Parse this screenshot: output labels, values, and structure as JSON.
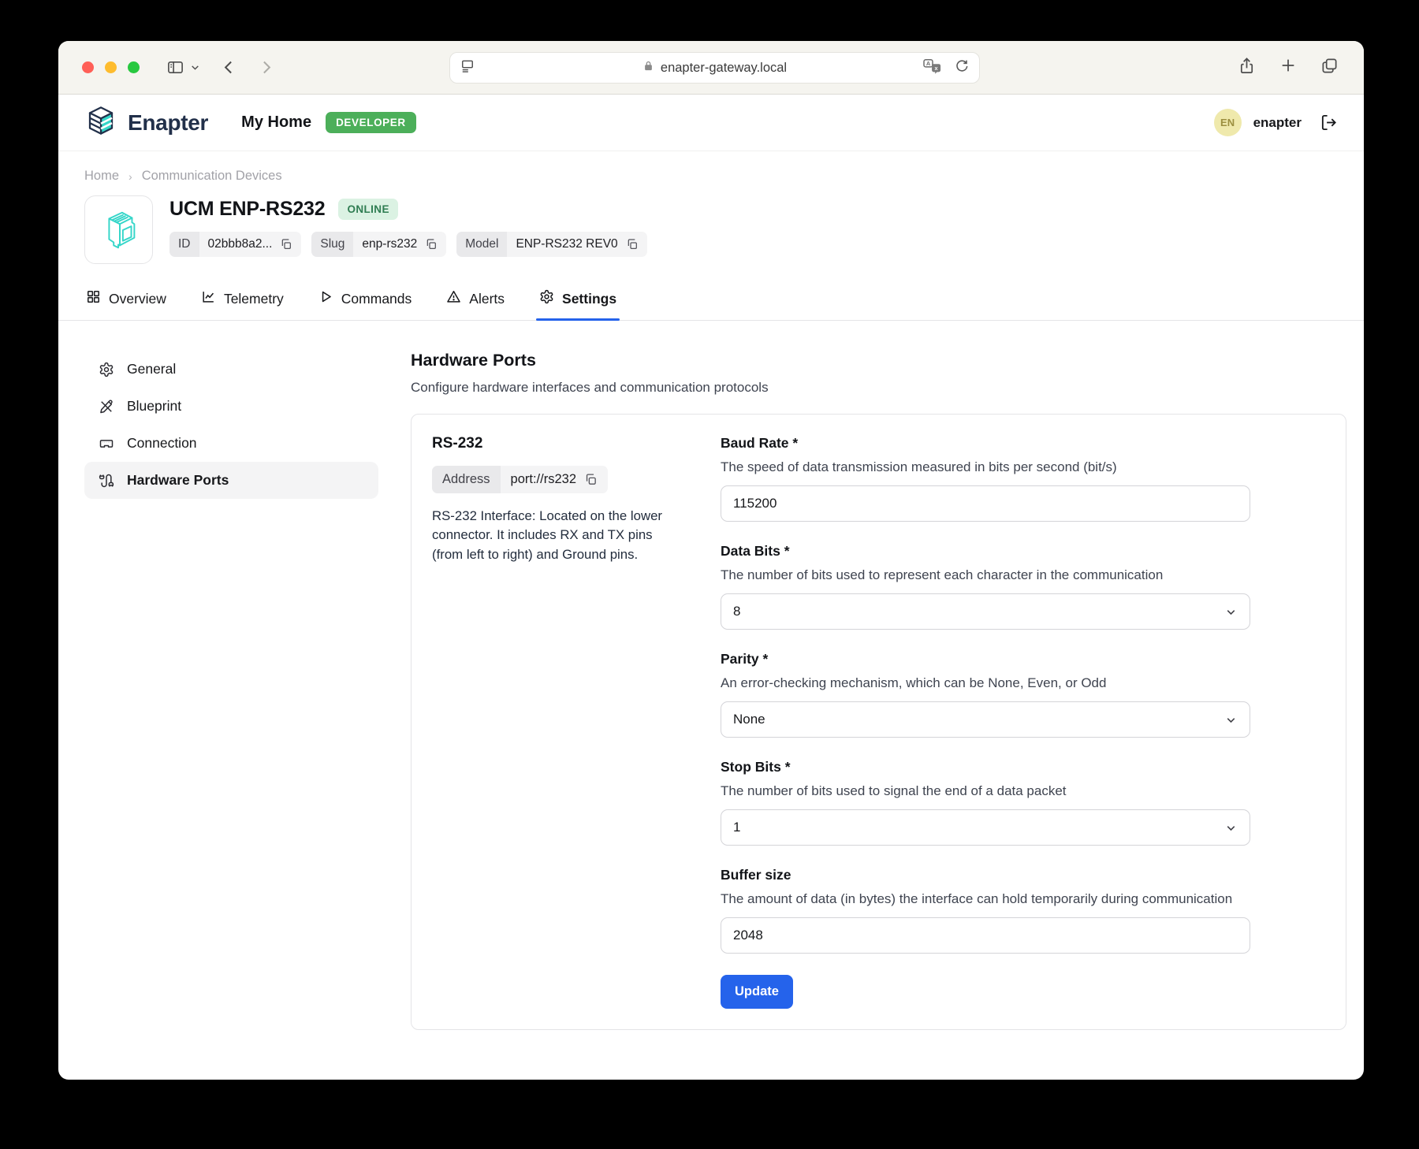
{
  "browser": {
    "url": "enapter-gateway.local"
  },
  "app_header": {
    "brand": "Enapter",
    "workspace": "My Home",
    "role_badge": "DEVELOPER",
    "user_initials": "EN",
    "user_name": "enapter"
  },
  "breadcrumb": {
    "home": "Home",
    "section": "Communication Devices"
  },
  "device": {
    "name": "UCM ENP-RS232",
    "status": "ONLINE",
    "meta": [
      {
        "key": "ID",
        "value": "02bbb8a2..."
      },
      {
        "key": "Slug",
        "value": "enp-rs232"
      },
      {
        "key": "Model",
        "value": "ENP-RS232 REV0"
      }
    ]
  },
  "tabs": {
    "items": [
      {
        "label": "Overview"
      },
      {
        "label": "Telemetry"
      },
      {
        "label": "Commands"
      },
      {
        "label": "Alerts"
      },
      {
        "label": "Settings"
      }
    ],
    "active": "Settings"
  },
  "settings_nav": {
    "items": [
      {
        "label": "General"
      },
      {
        "label": "Blueprint"
      },
      {
        "label": "Connection"
      },
      {
        "label": "Hardware Ports"
      }
    ],
    "active": "Hardware Ports"
  },
  "main": {
    "title": "Hardware Ports",
    "subtitle": "Configure hardware interfaces and communication protocols",
    "card": {
      "section_title": "RS-232",
      "address": {
        "key": "Address",
        "value": "port://rs232"
      },
      "description": "RS-232 Interface: Located on the lower connector. It includes RX and TX pins (from left to right) and Ground pins.",
      "fields": [
        {
          "label": "Baud Rate",
          "required_mark": "*",
          "help": "The speed of data transmission measured in bits per second (bit/s)",
          "value": "115200",
          "control": "input"
        },
        {
          "label": "Data Bits",
          "required_mark": "*",
          "help": "The number of bits used to represent each character in the communication",
          "value": "8",
          "control": "select"
        },
        {
          "label": "Parity",
          "required_mark": "*",
          "help": "An error-checking mechanism, which can be None, Even, or Odd",
          "value": "None",
          "control": "select"
        },
        {
          "label": "Stop Bits",
          "required_mark": "*",
          "help": "The number of bits used to signal the end of a data packet",
          "value": "1",
          "control": "select"
        },
        {
          "label": "Buffer size",
          "help": "The amount of data (in bytes) the interface can hold temporarily during communication",
          "value": "2048",
          "control": "input"
        }
      ],
      "submit_label": "Update"
    }
  },
  "colors": {
    "accent_blue": "#2563EB",
    "brand_teal": "#35D6C9",
    "brand_navy": "#22304A",
    "developer_badge_green": "#4CAF5A",
    "online_badge_bg": "#DBF2E3",
    "online_badge_text": "#2F7D52",
    "avatar_bg": "#EFE9AC",
    "avatar_text": "#9C8F3F"
  }
}
